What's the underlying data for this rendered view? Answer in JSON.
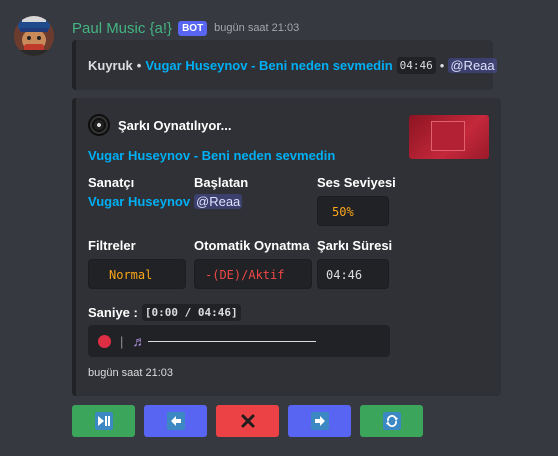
{
  "message": {
    "username": "Paul Music {a!}",
    "bot_tag": "BOT",
    "timestamp": "bugün saat 21:03"
  },
  "queue_embed": {
    "label": "Kuyruk",
    "bullet": "•",
    "song_link": "Vugar Huseynov - Beni neden sevmedin",
    "duration": "04:46",
    "bullet2": "•",
    "requester": "@Reaa"
  },
  "now_playing": {
    "author": "Şarkı Oynatılıyor...",
    "song_title": "Vugar Huseynov - Beni neden sevmedin",
    "fields": {
      "artist": {
        "name": "Sanatçı",
        "value": "Vugar Huseynov"
      },
      "started_by": {
        "name": "Başlatan",
        "value": "@Reaa"
      },
      "volume": {
        "name": "Ses Seviyesi",
        "value": "50%"
      },
      "filters": {
        "name": "Filtreler",
        "value": "Normal"
      },
      "autoplay": {
        "name": "Otomatik Oynatma",
        "value": "-(DE)/Aktif"
      },
      "duration": {
        "name": "Şarkı Süresi",
        "value": "04:46"
      }
    },
    "seconds_label": "Saniye :",
    "seconds_value": "[0:00 / 04:46]",
    "progress_separator": "|",
    "progress_fraction": 0.0,
    "footer": "bugün saat 21:03"
  },
  "buttons": [
    {
      "name": "play-pause",
      "icon": "play-pause-icon",
      "color": "#3ba55c"
    },
    {
      "name": "previous",
      "icon": "arrow-left-icon",
      "color": "#5865f2"
    },
    {
      "name": "stop",
      "icon": "close-icon",
      "color": "#ed4245"
    },
    {
      "name": "next",
      "icon": "arrow-right-icon",
      "color": "#5865f2"
    },
    {
      "name": "repeat",
      "icon": "repeat-icon",
      "color": "#3ba55c"
    }
  ],
  "colors": {
    "background": "#36393f",
    "embed": "#2f3136",
    "username": "#43b581",
    "link": "#00aff4",
    "volume_text": "#faa61a",
    "filter_text": "#faa61a",
    "autoplay_text": "#f04747"
  }
}
